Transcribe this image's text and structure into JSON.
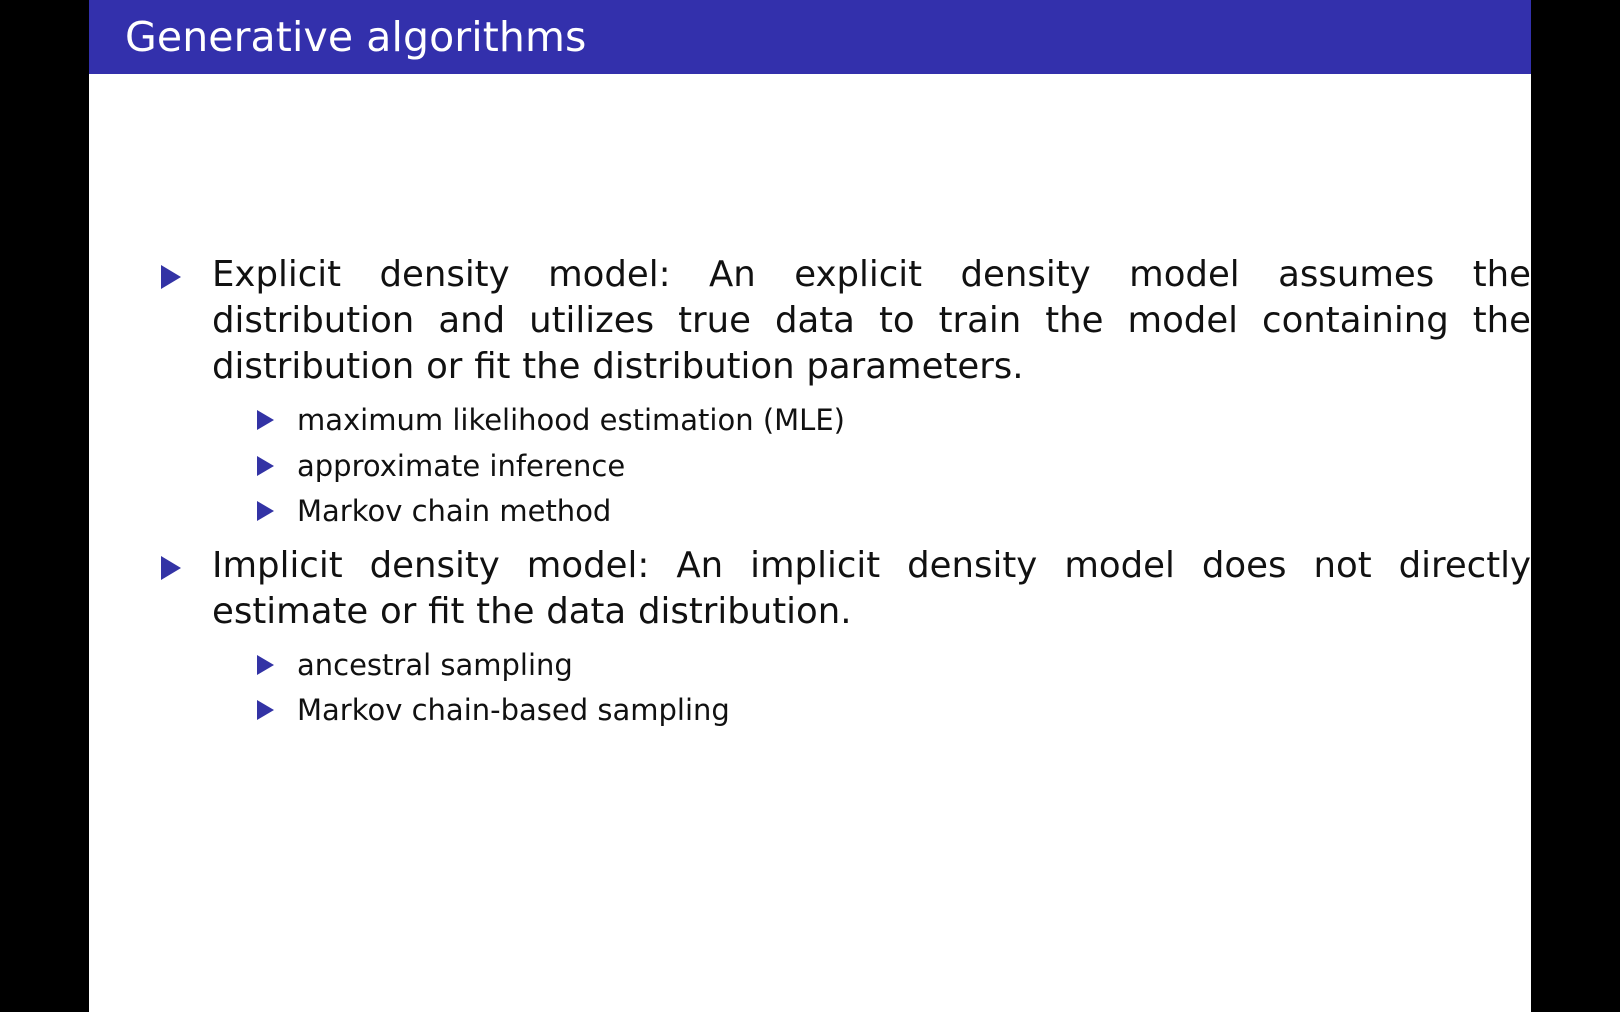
{
  "slide": {
    "title": "Generative algorithms",
    "theme": {
      "header_background": "#3330ac",
      "header_text_color": "#ffffff",
      "bullet_marker_color": "#3333a5",
      "body_background": "#ffffff",
      "body_text_color": "#111111",
      "letterbox_color": "#000000"
    },
    "bullets": [
      {
        "marker": "triangle-right-icon",
        "text": "Explicit density model: An explicit density model assumes the distribution and utilizes true data to train the model containing the distribution or fit the distribution parameters.",
        "sub_bullets": [
          {
            "marker": "triangle-right-icon",
            "text": "maximum likelihood estimation (MLE)"
          },
          {
            "marker": "triangle-right-icon",
            "text": "approximate inference"
          },
          {
            "marker": "triangle-right-icon",
            "text": "Markov chain method"
          }
        ]
      },
      {
        "marker": "triangle-right-icon",
        "text": "Implicit density model: An implicit density model does not directly estimate or fit the data distribution.",
        "sub_bullets": [
          {
            "marker": "triangle-right-icon",
            "text": "ancestral sampling"
          },
          {
            "marker": "triangle-right-icon",
            "text": "Markov chain-based sampling"
          }
        ]
      }
    ]
  }
}
